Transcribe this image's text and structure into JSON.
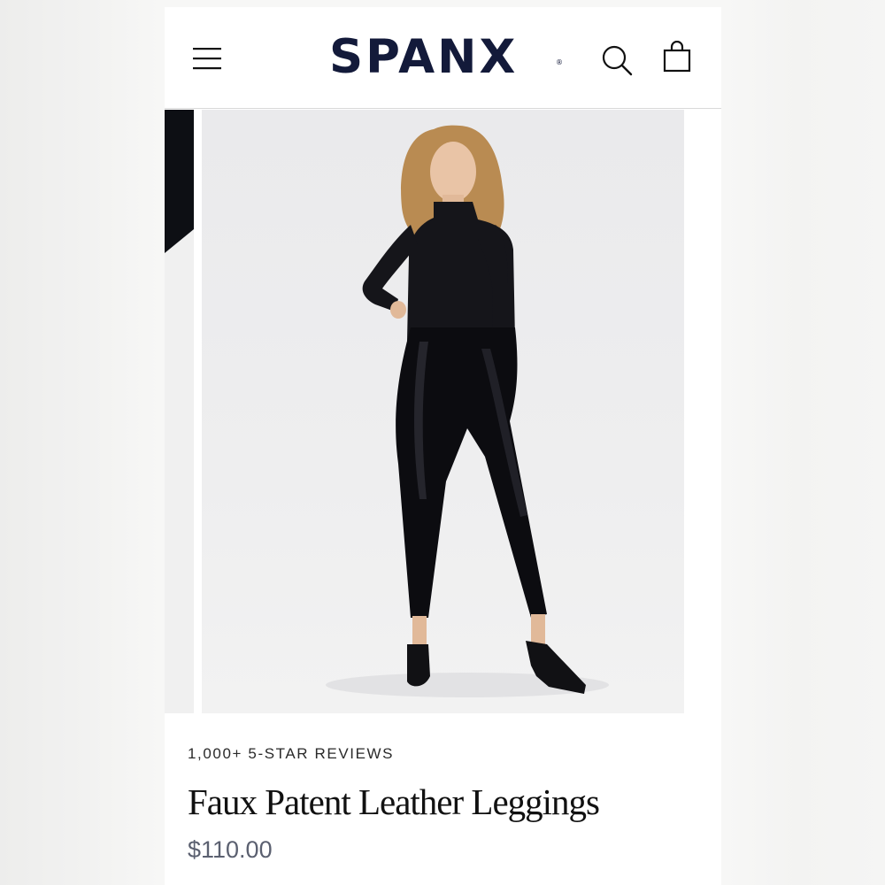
{
  "header": {
    "brand": "SPANX",
    "trademark": "®",
    "icons": [
      "hamburger-menu-icon",
      "search-icon",
      "shopping-bag-icon"
    ]
  },
  "product": {
    "reviews_label": "1,000+ 5-STAR REVIEWS",
    "name": "Faux Patent Leather Leggings",
    "price": "$110.00"
  },
  "colors": {
    "brand_navy": "#131a3a",
    "price_gray": "#5b6070",
    "title_black": "#111111"
  }
}
